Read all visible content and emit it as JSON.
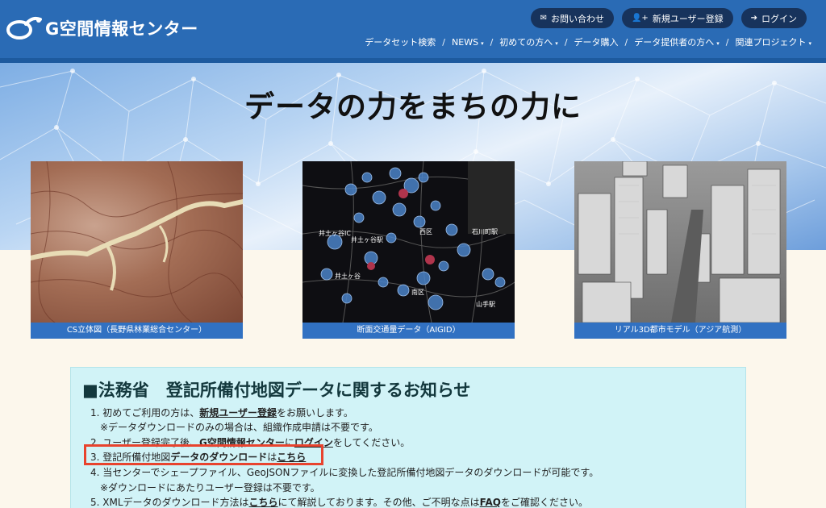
{
  "header": {
    "logo_text": "G空間情報センター",
    "buttons": [
      {
        "label": "お問い合わせ",
        "icon": "envelope-icon"
      },
      {
        "label": "新規ユーザー登録",
        "icon": "user-plus-icon"
      },
      {
        "label": "ログイン",
        "icon": "sign-in-icon"
      }
    ],
    "nav": [
      {
        "label": "データセット検索",
        "dropdown": false
      },
      {
        "label": "NEWS",
        "dropdown": true
      },
      {
        "label": "初めての方へ",
        "dropdown": true
      },
      {
        "label": "データ購入",
        "dropdown": false
      },
      {
        "label": "データ提供者の方へ",
        "dropdown": true
      },
      {
        "label": "関連プロジェクト",
        "dropdown": true
      }
    ],
    "nav_separator": "/",
    "caret": "▾"
  },
  "hero": {
    "title": "データの力をまちの力に"
  },
  "cards": [
    {
      "caption": "CS立体図（長野県林業総合センター）"
    },
    {
      "caption": "断面交通量データ（AIGID）",
      "map_labels": [
        "西区",
        "井土ヶ谷IC",
        "井土ヶ谷駅",
        "井土ヶ谷",
        "南区",
        "山手駅",
        "石川町駅"
      ]
    },
    {
      "caption": "リアル3D都市モデル（アジア航測）"
    }
  ],
  "notice": {
    "title": "■法務省　登記所備付地図データに関するお知らせ",
    "lines": {
      "l1_pre": "1. 初めてご利用の方は、",
      "l1_link": "新規ユーザー登録",
      "l1_post": "をお願いします。",
      "l1_note": "※データダウンロードのみの場合は、組織作成申請は不要です。",
      "l2_pre": "2. ユーザー登録完了後、",
      "l2_bold": "G空間情報センター",
      "l2_mid": "に",
      "l2_link": "ログイン",
      "l2_post": "をしてください。",
      "l3_pre": "3. 登記所備付地図",
      "l3_bold": "データのダウンロード",
      "l3_mid": "は",
      "l3_link": "こちら",
      "l4": "4. 当センターでシェープファイル、GeoJSONファイルに変換した登記所備付地図データのダウンロードが可能です。",
      "l4_note": "※ダウンロードにあたりユーザー登録は不要です。",
      "l5_pre": "5. XMLデータのダウンロード方法は",
      "l5_link": "こちら",
      "l5_mid": "にて解説しております。その他、ご不明な点は",
      "l5_faq": "FAQ",
      "l5_post": "をご確認ください。"
    }
  },
  "colors": {
    "header": "#2a6bb5",
    "pill": "#17335c",
    "caption": "#3171c2",
    "notice_bg": "#d1f3f7",
    "highlight": "#e8432e"
  }
}
